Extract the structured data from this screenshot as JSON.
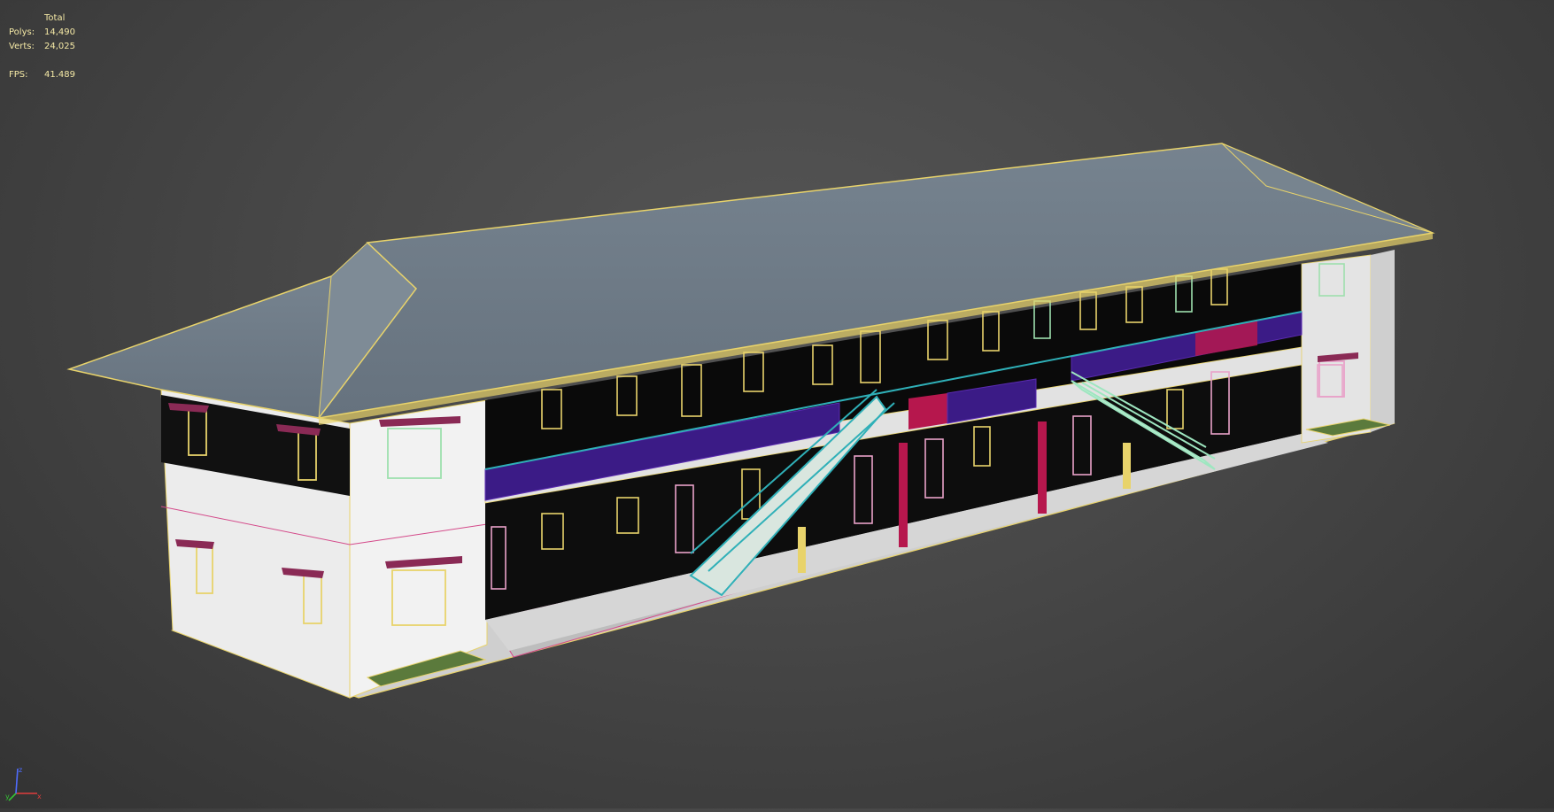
{
  "viewport": {
    "stats": {
      "header": "Total",
      "polys_label": "Polys:",
      "polys_value": "14,490",
      "verts_label": "Verts:",
      "verts_value": "24,025",
      "fps_label": "FPS:",
      "fps_value": "41.489"
    },
    "axis": {
      "x": "x",
      "y": "y",
      "z": "z"
    },
    "colors": {
      "background": "#474747",
      "stats_text": "#f5e9a6",
      "roof": "#6b7885",
      "wall": "#e9e9e9",
      "window_yellow": "#e8d36b",
      "window_green": "#9ee0ae",
      "window_pink": "#e9a2c9",
      "railing_purple": "#5a2bb0",
      "railing_red": "#b6174d",
      "stairs_cyan": "#2fb0b8",
      "stairs_mint": "#9ee6c0"
    },
    "icons": [
      "axis-gizmo-icon"
    ]
  }
}
